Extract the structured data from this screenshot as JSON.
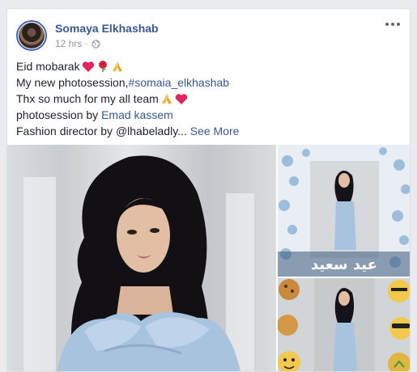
{
  "post": {
    "author": "Somaya Elkhashab",
    "time": "12 hrs",
    "lines": [
      "Eid mobarak",
      "My new photosession,",
      "Thx so much for my all team",
      "photosession by ",
      "Fashion director by @lhabeladly..."
    ],
    "hashtag": "#somaia_elkhashab",
    "photographer": "Emad kassem",
    "see_more": "See More",
    "overlay_text": "عيد سعيد"
  },
  "icons": {
    "privacy": "globe-icon",
    "menu": "more-options-icon",
    "emojis_line1": [
      "heart-icon",
      "rose-icon",
      "folded-hands-icon"
    ],
    "emojis_line3": [
      "folded-hands-icon",
      "heart-icon"
    ]
  },
  "colors": {
    "name": "#385898",
    "link": "#385898",
    "text": "#1d2129",
    "meta": "#90949c",
    "dress": "#a8c3de"
  }
}
